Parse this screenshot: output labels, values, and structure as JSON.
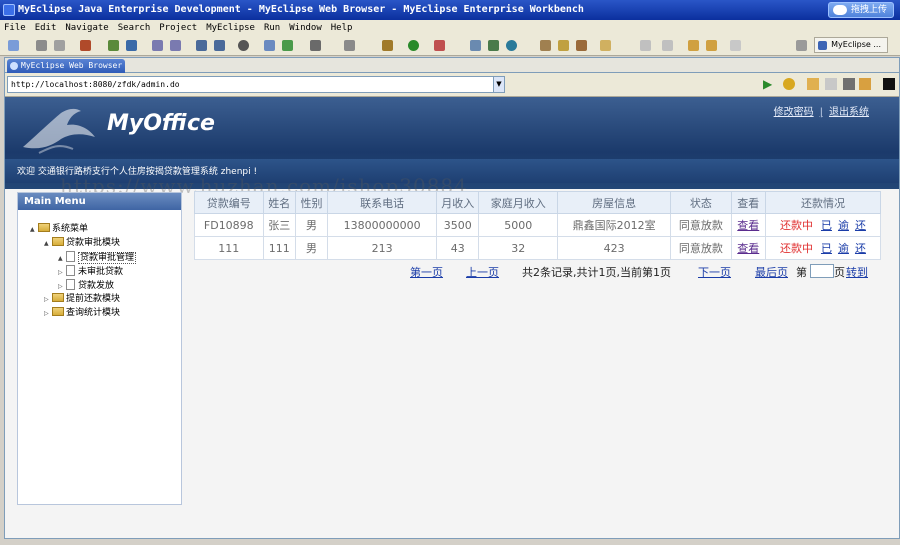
{
  "window": {
    "title": "MyEclipse Java Enterprise Development - MyEclipse Web Browser - MyEclipse Enterprise Workbench",
    "cloud_button": "拖拽上传",
    "perspective": "MyEclipse ..."
  },
  "menubar": [
    "File",
    "Edit",
    "Navigate",
    "Search",
    "Project",
    "MyEclipse",
    "Run",
    "Window",
    "Help"
  ],
  "editor_tab": "MyEclipse Web Browser",
  "address": {
    "url": "http://localhost:8080/zfdk/admin.do"
  },
  "watermark": "https://www.huzhan.com/ishop30884",
  "app": {
    "logo": "MyOffice",
    "change_password": "修改密码",
    "separator": "|",
    "logout": "退出系统",
    "welcome": "欢迎 交通银行路桥支行个人住房按揭贷款管理系统 zhenpi !"
  },
  "sidebar": {
    "title": "Main Menu",
    "tree": [
      {
        "label": "系统菜单",
        "level": 0,
        "toggle": "▲",
        "type": "folder"
      },
      {
        "label": "贷款审批模块",
        "level": 1,
        "toggle": "▲",
        "type": "folder"
      },
      {
        "label": "贷款审批管理",
        "level": 2,
        "toggle": "▲",
        "type": "doc",
        "selected": true
      },
      {
        "label": "未审批贷款",
        "level": 2,
        "toggle": "▷",
        "type": "doc"
      },
      {
        "label": "贷款发放",
        "level": 2,
        "toggle": "▷",
        "type": "doc"
      },
      {
        "label": "提前还款模块",
        "level": 0,
        "toggle": "▷",
        "type": "folder"
      },
      {
        "label": "查询统计模块",
        "level": 0,
        "toggle": "▷",
        "type": "folder"
      }
    ]
  },
  "table": {
    "headers": [
      "贷款编号",
      "姓名",
      "性别",
      "联系电话",
      "月收入",
      "家庭月收入",
      "房屋信息",
      "状态",
      "查看",
      "还款情况"
    ],
    "rows": [
      {
        "id": "FD10898",
        "name": "张三",
        "gender": "男",
        "phone": "13800000000",
        "income": "3500",
        "family_income": "5000",
        "house": "鼎鑫国际2012室",
        "status": "同意放款",
        "view": "查看",
        "repay": [
          "还款中",
          "已",
          "逾",
          "还"
        ]
      },
      {
        "id": "111",
        "name": "111",
        "gender": "男",
        "phone": "213",
        "income": "43",
        "family_income": "32",
        "house": "423",
        "status": "同意放款",
        "view": "查看",
        "repay": [
          "还款中",
          "已",
          "逾",
          "还"
        ]
      }
    ]
  },
  "pager": {
    "first": "第一页",
    "prev": "上一页",
    "summary": "共2条记录,共计1页,当前第1页",
    "next": "下一页",
    "last": "最后页",
    "goto_prefix": "第",
    "goto_suffix": "页",
    "goto": "转到"
  }
}
